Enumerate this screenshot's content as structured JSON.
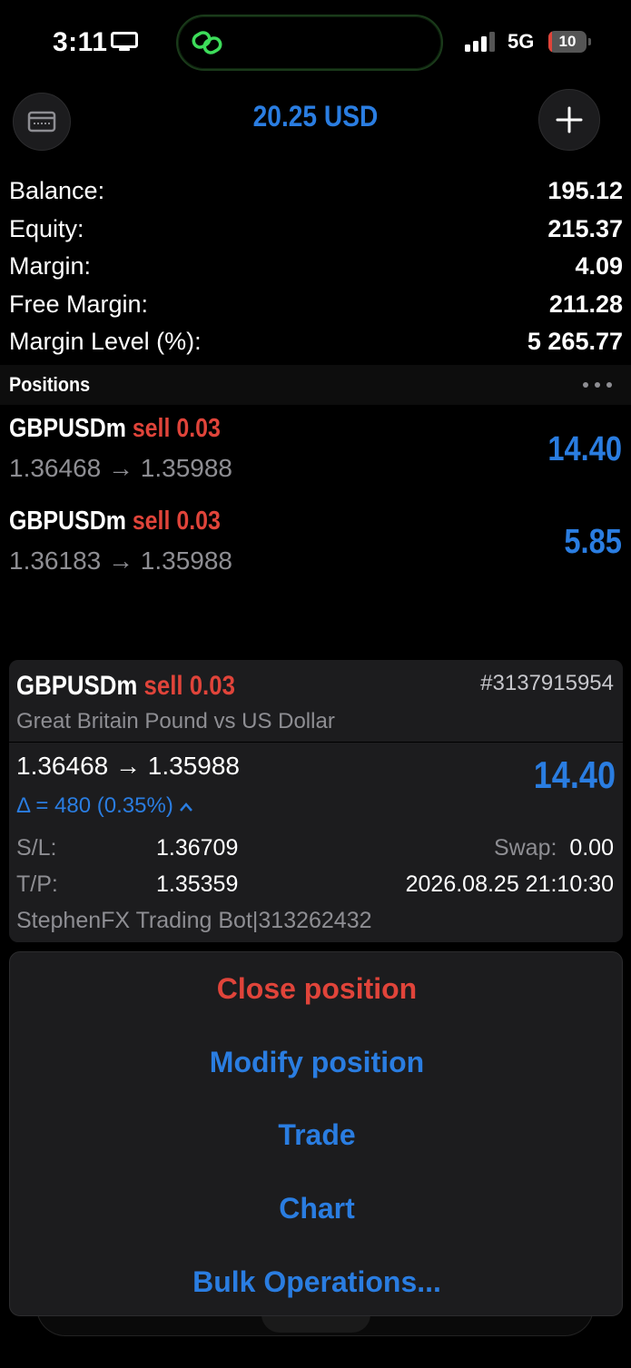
{
  "status_bar": {
    "time": "3:11",
    "network": "5G",
    "battery_level": "10",
    "battery_fraction": 0.1,
    "battery_color": "#e0443a"
  },
  "header": {
    "title": "20.25 USD",
    "left_icon": "wallet-icon",
    "right_icon": "plus-icon"
  },
  "account": {
    "rows": [
      {
        "label": "Balance:",
        "value": "195.12"
      },
      {
        "label": "Equity:",
        "value": "215.37"
      },
      {
        "label": "Margin:",
        "value": "4.09"
      },
      {
        "label": "Free Margin:",
        "value": "211.28"
      },
      {
        "label": "Margin Level (%):",
        "value": "5 265.77"
      }
    ]
  },
  "positions": {
    "title": "Positions",
    "items": [
      {
        "symbol": "GBPUSDm",
        "side": "sell 0.03",
        "prices": "1.36468 → 1.35988",
        "profit": "14.40"
      },
      {
        "symbol": "GBPUSDm",
        "side": "sell 0.03",
        "prices": "1.36183 → 1.35988",
        "profit": "5.85"
      }
    ]
  },
  "detail": {
    "symbol": "GBPUSDm",
    "side": "sell 0.03",
    "ticket": "#3137915954",
    "description": "Great Britain Pound vs US Dollar",
    "prices": "1.36468 → 1.35988",
    "delta": "Δ = 480 (0.35%)",
    "profit": "14.40",
    "sl_label": "S/L:",
    "sl_value": "1.36709",
    "tp_label": "T/P:",
    "tp_value": "1.35359",
    "swap_label": "Swap:",
    "swap_value": "0.00",
    "time": "2026.08.25 21:10:30",
    "comment": "StephenFX Trading Bot|313262432"
  },
  "action_sheet": {
    "close": "Close position",
    "modify": "Modify position",
    "trade": "Trade",
    "chart": "Chart",
    "bulk": "Bulk Operations..."
  },
  "colors": {
    "accent_blue": "#2a7de1",
    "sell_red": "#e0443a",
    "background": "#000000",
    "card": "#1c1c1e"
  }
}
